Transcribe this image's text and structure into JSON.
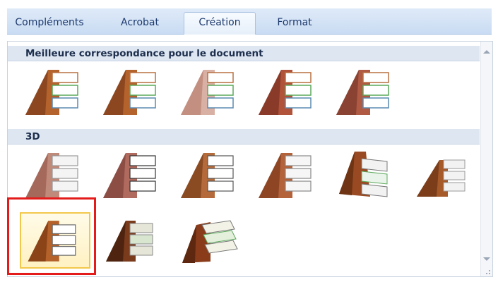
{
  "tabs": [
    {
      "label": "Compléments"
    },
    {
      "label": "Acrobat"
    },
    {
      "label": "Création"
    },
    {
      "label": "Format"
    }
  ],
  "gallery": {
    "sections": [
      {
        "title": "Meilleure correspondance pour le document"
      },
      {
        "title": "3D"
      }
    ]
  },
  "colors": {
    "accent": "#e41b1b",
    "selection_fill": "#fff1c2",
    "pyramid": "#b0602c",
    "box_green": "#4aa84a"
  }
}
